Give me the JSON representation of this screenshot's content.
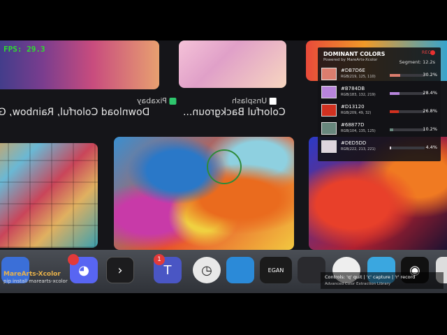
{
  "hud": {
    "fps": "FPS: 29.3"
  },
  "browser": {
    "result_1": {
      "source": "Pixabay",
      "caption": "Download Colorful, Rainbow, Gr"
    },
    "result_2": {
      "source": "Unsplash",
      "caption": "Colorful Backgroun..."
    }
  },
  "panel": {
    "title": "DOMINANT COLORS",
    "subtitle": "Powered by MareArts-Xcolor",
    "segment": "Segment: 12.2s",
    "rec": "REC",
    "colors": [
      {
        "hex": "#DB7D6E",
        "rgb": "RGB(219, 125, 110)",
        "percent": "30.2%",
        "fraction": 0.302,
        "bar_color": "#DB7D6E"
      },
      {
        "hex": "#B784DB",
        "rgb": "RGB(183, 132, 219)",
        "percent": "28.4%",
        "fraction": 0.284,
        "bar_color": "#B784DB"
      },
      {
        "hex": "#D13120",
        "rgb": "RGB(209, 49, 32)",
        "percent": "26.8%",
        "fraction": 0.268,
        "bar_color": "#D13120"
      },
      {
        "hex": "#68877D",
        "rgb": "RGB(104, 135, 125)",
        "percent": "10.2%",
        "fraction": 0.102,
        "bar_color": "#68877D"
      },
      {
        "hex": "#DED5DD",
        "rgb": "RGB(222, 213, 221)",
        "percent": "4.4%",
        "fraction": 0.044,
        "bar_color": "#DED5DD"
      }
    ]
  },
  "footer": {
    "app_name": "MareArts-Xcolor",
    "install": "pip install marearts-xcolor",
    "controls": "Controls: 'q' quit | 'c' capture | 'r' record",
    "library": "Advanced Color Extraction Library"
  },
  "dock": {
    "badge_1": "",
    "badge_2": "1",
    "app_label": "EGAN"
  }
}
